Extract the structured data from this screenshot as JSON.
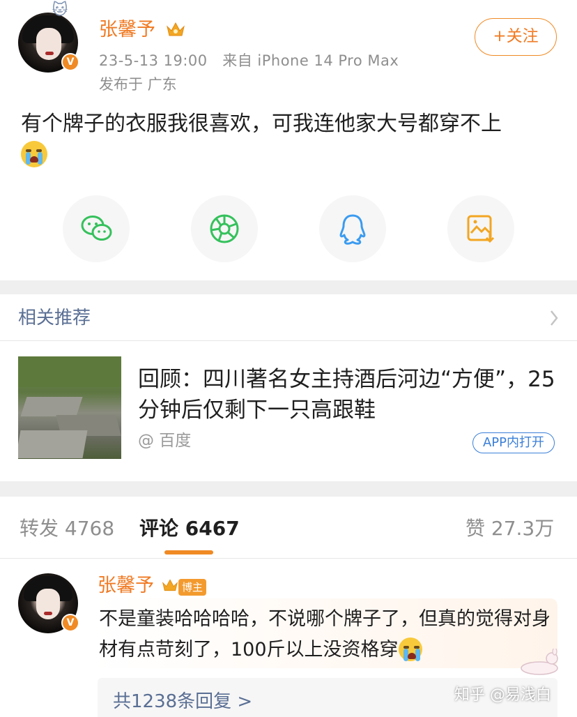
{
  "post": {
    "username": "张馨予",
    "timestamp": "23-5-13 19:00",
    "source": "来自 iPhone 14 Pro Max",
    "location": "发布于 广东",
    "follow_label": "+关注",
    "text": "有个牌子的衣服我很喜欢，可我连他家大号都穿不上",
    "emoji": "cry-emoji",
    "verified_mark": "V",
    "crown_icon": "crown-icon"
  },
  "share": {
    "items": [
      "wechat-icon",
      "moments-icon",
      "qq-icon",
      "save-image-icon"
    ]
  },
  "related": {
    "title": "相关推荐",
    "article_title": "回顾：四川著名女主持酒后河边“方便”，25分钟后仅剩下一只高跟鞋",
    "article_source": "@ 百度",
    "app_open_label": "APP内打开"
  },
  "tabs": {
    "repost": "转发 4768",
    "comments_label": "评论",
    "comments_count": "6467",
    "likes": "赞 27.3万"
  },
  "comment": {
    "username": "张馨予",
    "badge": "博主",
    "text": "不是童装哈哈哈哈，不说哪个牌子了，但真的觉得对身材有点苛刻了，100斤以上没资格穿",
    "replies_link": "共1238条回复 >"
  },
  "watermark": "知乎 @易浅白",
  "colors": {
    "brand_orange": "#f07a23",
    "link_blue": "#5a6f94",
    "wechat_green": "#35c15c",
    "qq_blue": "#3a9bf0",
    "save_orange": "#f2a623"
  }
}
